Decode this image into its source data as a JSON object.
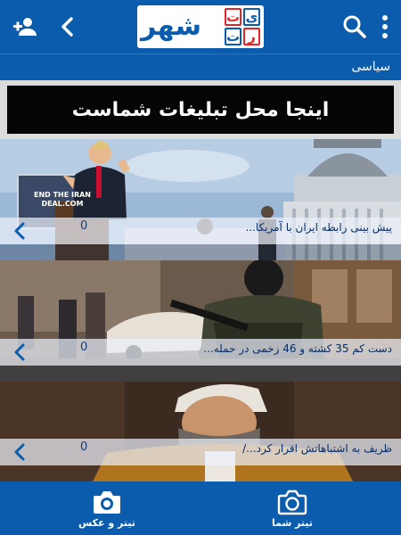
{
  "header": {
    "logo_word": "شهر",
    "logo_letters": [
      "ت",
      "ی",
      "ت",
      "ر"
    ],
    "icons": [
      "add-user-icon",
      "back-arrow-icon",
      "search-icon",
      "more-vert-icon"
    ]
  },
  "category": {
    "label": "سیاسی"
  },
  "ad": {
    "text": "اینجا محل تبلیغات شماست"
  },
  "news": [
    {
      "title": "پیش بینی رابطه ایران با آمریکا...",
      "count": "0",
      "sign_text": "END THE IRAN DEAL.COM"
    },
    {
      "title": "دست کم 35 کشته و 46 زخمی در حمله...",
      "count": "0"
    },
    {
      "title": "ظریف به اشتباهاتش اقرار کرد.../",
      "count": "0"
    }
  ],
  "bottom_nav": {
    "left_label": "تیتر و عکس",
    "right_label": "تیتر شما"
  },
  "colors": {
    "primary": "#0b5cad",
    "logo_red": "#e0262b"
  }
}
